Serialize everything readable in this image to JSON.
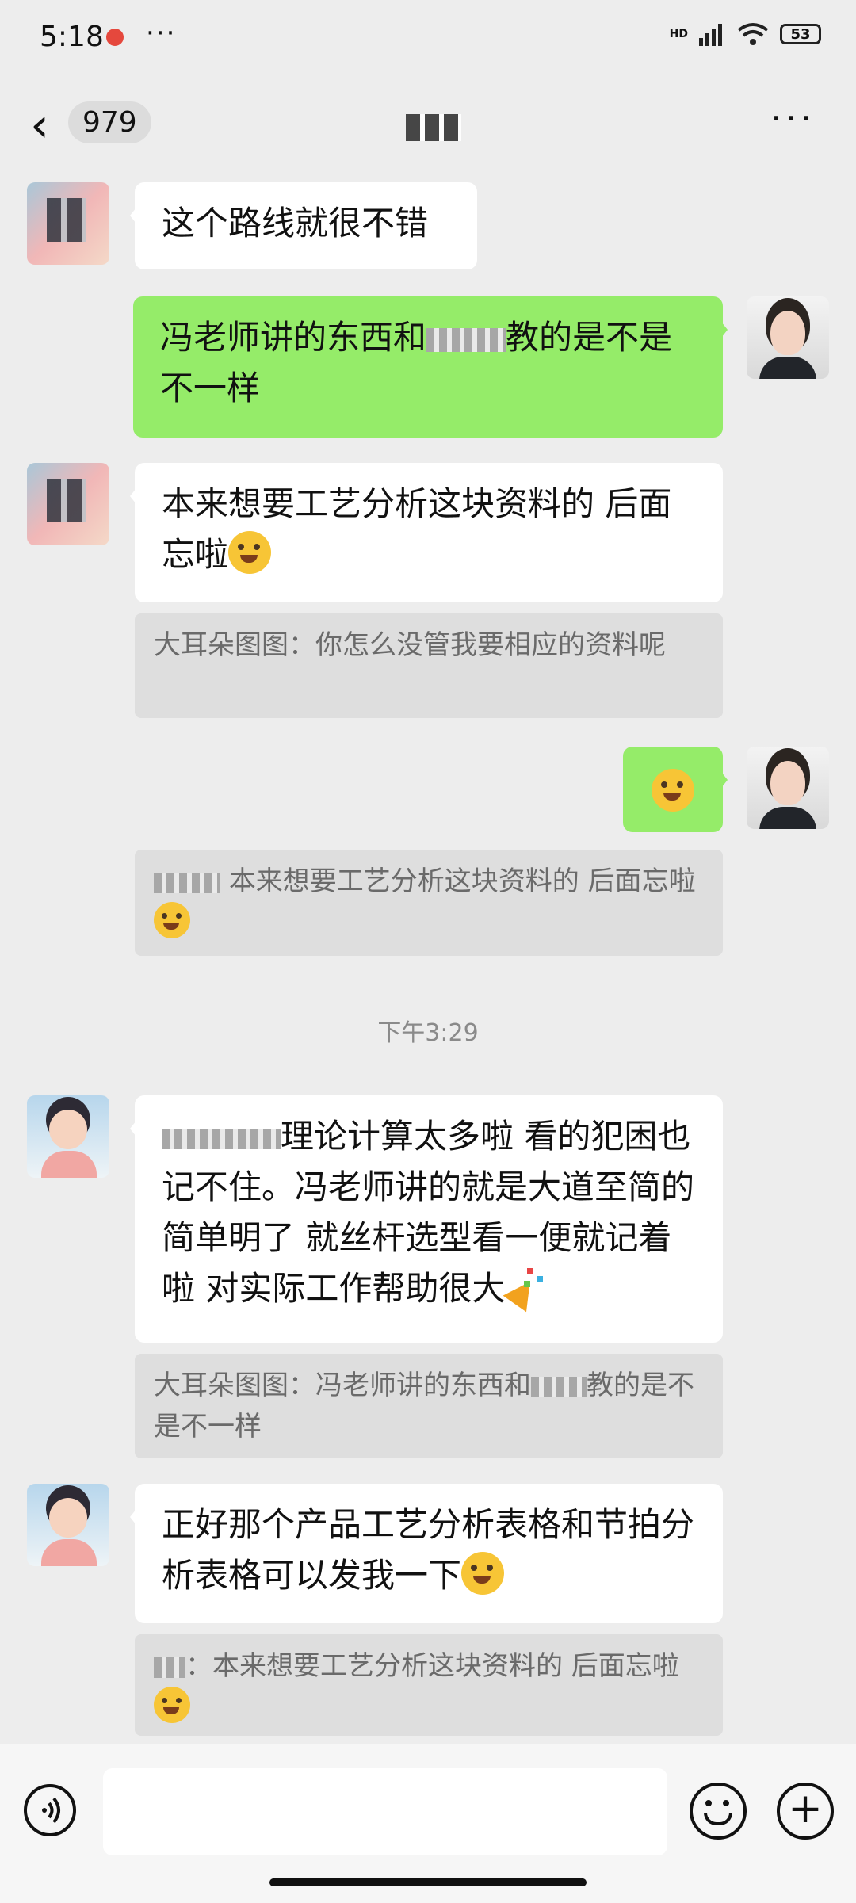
{
  "status_bar": {
    "time": "5:18",
    "dots": "···",
    "network": "HD",
    "battery": "53"
  },
  "header": {
    "back_icon": "‹",
    "unread_count": "979",
    "more_icon": "···"
  },
  "messages": [
    {
      "side": "in",
      "text": "这个路线就很不错"
    },
    {
      "side": "out",
      "text_a": "冯老师讲的东西和",
      "text_b": "教的是不是不一样"
    },
    {
      "side": "in",
      "text": "本来想要工艺分析这块资料的 后面忘啦",
      "quote": "大耳朵图图：你怎么没管我要相应的资料呢"
    },
    {
      "side": "out",
      "emoji": "flushed-face",
      "quote": "本来想要工艺分析这块资料的 后面忘啦"
    },
    {
      "timestamp": "下午3:29"
    },
    {
      "side": "in",
      "text_a": "理论计算太多啦 看的犯困也记不住。冯老师讲的就是大道至简的 简单明了 就丝杆选型看一便就记着啦 对实际工作帮助很大",
      "quote_a": "大耳朵图图：冯老师讲的东西和",
      "quote_b": "教的是不是不一样"
    },
    {
      "side": "in",
      "text": "正好那个产品工艺分析表格和节拍分析表格可以发我一下",
      "quote": "：本来想要工艺分析这块资料的 后面忘啦"
    }
  ],
  "input_bar": {
    "voice_icon": "voice-icon",
    "emoji_icon": "smile-icon",
    "plus_icon": "+"
  }
}
